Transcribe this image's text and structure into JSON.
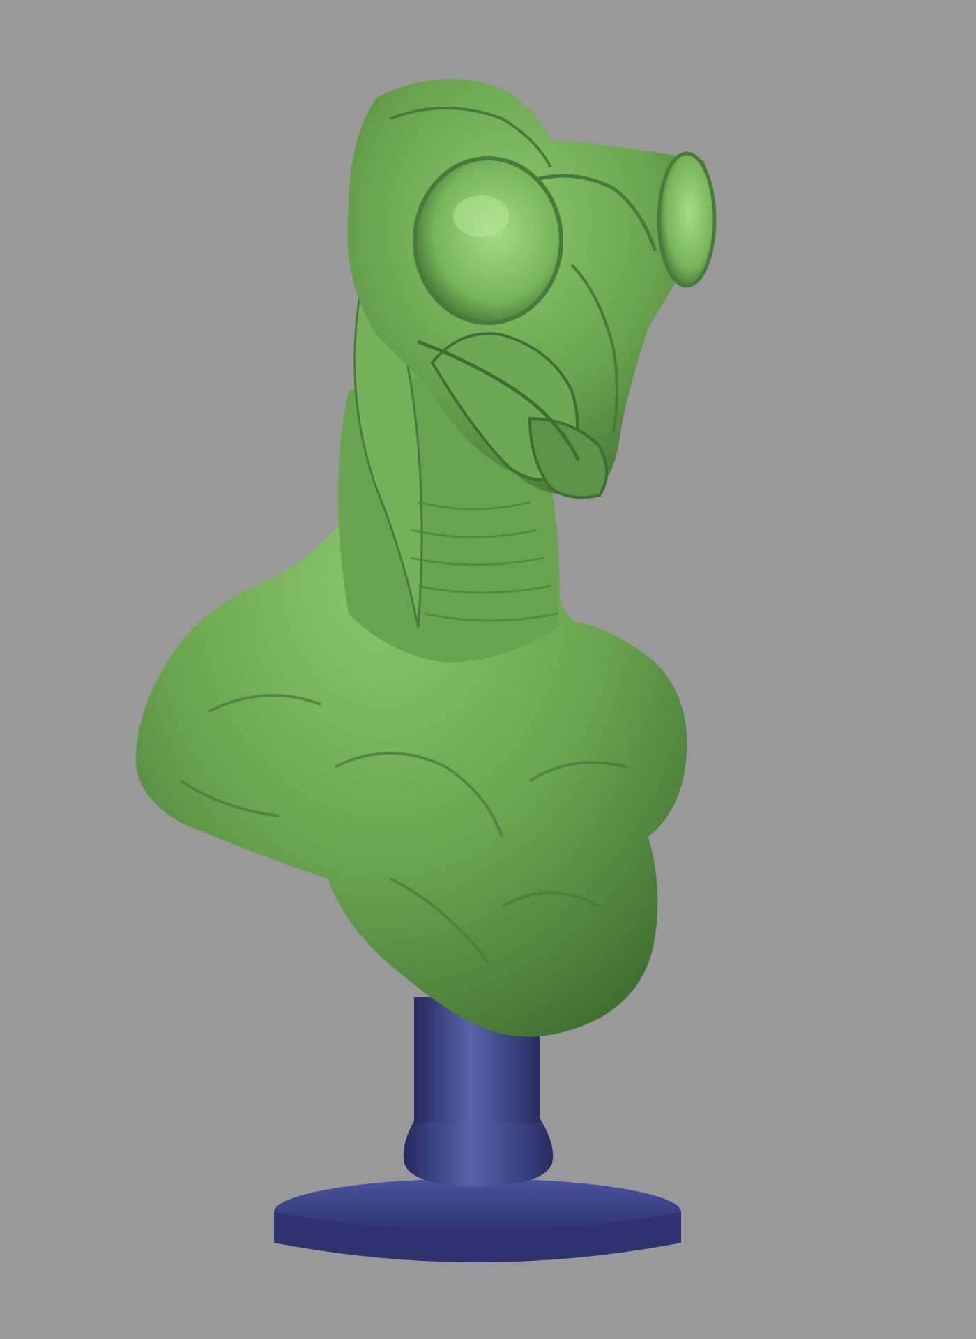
{
  "viewport": {
    "background_color": "#999999"
  },
  "sculpt": {
    "subject": "alien-insectoid-bust",
    "skin_color": "#6fa855",
    "skin_highlight": "#93cc76",
    "skin_shadow": "#3f6e30",
    "eye_color": "#8fcc6e"
  },
  "stand": {
    "color": "#3b4487",
    "highlight": "#5e67b0",
    "shadow": "#232a5e"
  }
}
